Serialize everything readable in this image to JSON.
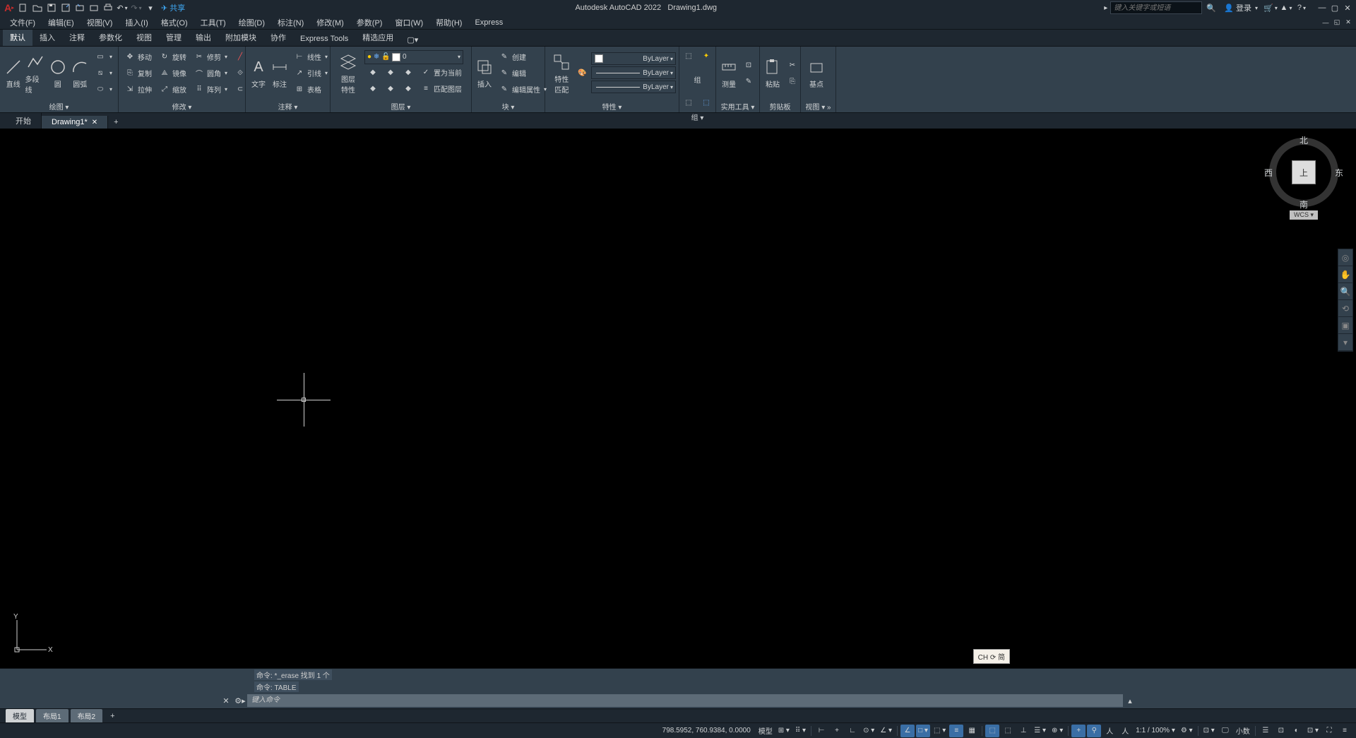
{
  "app": {
    "name": "Autodesk AutoCAD 2022",
    "filename": "Drawing1.dwg",
    "share_label": "共享",
    "search_placeholder": "键入关键字或短语",
    "login_label": "登录"
  },
  "menu": {
    "items": [
      {
        "label": "文件(F)"
      },
      {
        "label": "编辑(E)"
      },
      {
        "label": "视图(V)"
      },
      {
        "label": "插入(I)"
      },
      {
        "label": "格式(O)"
      },
      {
        "label": "工具(T)"
      },
      {
        "label": "绘图(D)"
      },
      {
        "label": "标注(N)"
      },
      {
        "label": "修改(M)"
      },
      {
        "label": "参数(P)"
      },
      {
        "label": "窗口(W)"
      },
      {
        "label": "帮助(H)"
      },
      {
        "label": "Express"
      }
    ]
  },
  "ribbon_tabs": [
    {
      "label": "默认",
      "active": true
    },
    {
      "label": "插入"
    },
    {
      "label": "注释"
    },
    {
      "label": "参数化"
    },
    {
      "label": "视图"
    },
    {
      "label": "管理"
    },
    {
      "label": "输出"
    },
    {
      "label": "附加模块"
    },
    {
      "label": "协作"
    },
    {
      "label": "Express Tools"
    },
    {
      "label": "精选应用"
    }
  ],
  "panels": {
    "draw": {
      "title": "绘图 ▾",
      "btns": {
        "line": "直线",
        "polyline": "多段线",
        "circle": "圆",
        "arc": "圆弧"
      }
    },
    "modify": {
      "title": "修改 ▾",
      "r1": {
        "move": "移动",
        "rotate": "旋转",
        "trim": "修剪"
      },
      "r2": {
        "copy": "复制",
        "mirror": "镜像",
        "fillet": "圆角"
      },
      "r3": {
        "stretch": "拉伸",
        "scale": "缩放",
        "array": "阵列"
      }
    },
    "annotate": {
      "title": "注释 ▾",
      "text": "文字",
      "dim": "标注",
      "table": "表格",
      "r1": "线性",
      "r2": "引线",
      "r3": "表格"
    },
    "layers": {
      "title": "图层 ▾",
      "btn": "图层\n特性",
      "current": "0",
      "r1": "置为当前",
      "r2": "匹配图层"
    },
    "block": {
      "title": "块 ▾",
      "btn": "插入",
      "r1": "创建",
      "r2": "编辑",
      "r3": "编辑属性"
    },
    "props": {
      "title": "特性 ▾",
      "btn": "特性\n匹配",
      "layer": "ByLayer",
      "lw": "ByLayer",
      "lt": "ByLayer"
    },
    "group": {
      "title": "组 ▾",
      "btn": "组"
    },
    "utils": {
      "title": "实用工具 ▾",
      "btn": "测量"
    },
    "clipboard": {
      "title": "剪贴板",
      "btn": "粘贴"
    },
    "view": {
      "title": "视图 ▾ »",
      "btn": "基点"
    }
  },
  "file_tabs": {
    "start": "开始",
    "drawing": "Drawing1*"
  },
  "viewcube": {
    "top": "上",
    "n": "北",
    "s": "南",
    "e": "东",
    "w": "西",
    "wcs": "WCS"
  },
  "ucs": {
    "x": "X",
    "y": "Y"
  },
  "ime": "CH ⟳ 简",
  "cmd": {
    "hist1": "命令: *_erase 找到 1 个",
    "hist2": "命令: TABLE",
    "placeholder": "键入命令"
  },
  "layout_tabs": {
    "model": "模型",
    "l1": "布局1",
    "l2": "布局2"
  },
  "status": {
    "coords": "798.5952, 760.9384, 0.0000",
    "model": "模型",
    "scale": "1:1 / 100%",
    "decimal": "小数"
  }
}
